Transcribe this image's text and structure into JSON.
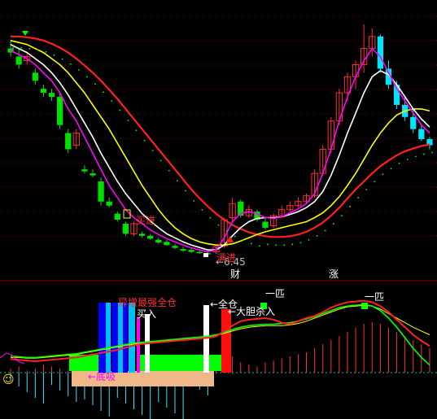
{
  "chart_data": [
    {
      "type": "candlestick",
      "title": "",
      "price_low_label": "6.45",
      "signals": {
        "buy_label": "买进",
        "fill_label": "满进",
        "buy_arrow_prefix": "←"
      },
      "badges": {
        "cai": "财",
        "zhang": "涨"
      },
      "candles": [
        {
          "o": 11.6,
          "h": 11.8,
          "l": 11.4,
          "c": 11.5,
          "up": false
        },
        {
          "o": 11.4,
          "h": 11.6,
          "l": 11.1,
          "c": 11.2,
          "up": false
        },
        {
          "o": 11.3,
          "h": 11.5,
          "l": 11.2,
          "c": 11.4,
          "up": true
        },
        {
          "o": 11.0,
          "h": 11.1,
          "l": 10.7,
          "c": 10.8,
          "up": false
        },
        {
          "o": 10.6,
          "h": 10.7,
          "l": 10.4,
          "c": 10.5,
          "up": false
        },
        {
          "o": 10.5,
          "h": 10.6,
          "l": 10.3,
          "c": 10.4,
          "up": false
        },
        {
          "o": 10.4,
          "h": 10.5,
          "l": 9.6,
          "c": 9.7,
          "up": false
        },
        {
          "o": 9.5,
          "h": 9.6,
          "l": 9.0,
          "c": 9.1,
          "up": false
        },
        {
          "o": 9.2,
          "h": 9.6,
          "l": 9.1,
          "c": 9.5,
          "up": true
        },
        {
          "o": 8.6,
          "h": 8.7,
          "l": 8.5,
          "c": 8.55,
          "up": false
        },
        {
          "o": 8.5,
          "h": 8.6,
          "l": 8.4,
          "c": 8.45,
          "up": false
        },
        {
          "o": 8.3,
          "h": 8.4,
          "l": 7.7,
          "c": 7.8,
          "up": false
        },
        {
          "o": 7.8,
          "h": 7.9,
          "l": 7.65,
          "c": 7.7,
          "up": false
        },
        {
          "o": 7.5,
          "h": 7.55,
          "l": 7.3,
          "c": 7.35,
          "up": false
        },
        {
          "o": 7.25,
          "h": 7.3,
          "l": 6.95,
          "c": 7.0,
          "up": false
        },
        {
          "o": 7.0,
          "h": 7.3,
          "l": 6.95,
          "c": 7.25,
          "up": true
        },
        {
          "o": 7.0,
          "h": 7.05,
          "l": 6.9,
          "c": 6.95,
          "up": false
        },
        {
          "o": 6.95,
          "h": 7.0,
          "l": 6.85,
          "c": 6.88,
          "up": false
        },
        {
          "o": 6.85,
          "h": 6.9,
          "l": 6.75,
          "c": 6.78,
          "up": false
        },
        {
          "o": 6.8,
          "h": 6.85,
          "l": 6.7,
          "c": 6.72,
          "up": false
        },
        {
          "o": 6.7,
          "h": 6.75,
          "l": 6.62,
          "c": 6.65,
          "up": false
        },
        {
          "o": 6.62,
          "h": 6.68,
          "l": 6.55,
          "c": 6.58,
          "up": false
        },
        {
          "o": 6.6,
          "h": 6.65,
          "l": 6.52,
          "c": 6.55,
          "up": false
        },
        {
          "o": 6.55,
          "h": 6.6,
          "l": 6.5,
          "c": 6.52,
          "up": false
        },
        {
          "o": 6.52,
          "h": 6.58,
          "l": 6.45,
          "c": 6.5,
          "up": false
        },
        {
          "o": 6.55,
          "h": 6.7,
          "l": 6.5,
          "c": 6.68,
          "up": true
        },
        {
          "o": 6.7,
          "h": 7.4,
          "l": 6.65,
          "c": 7.35,
          "up": true
        },
        {
          "o": 7.4,
          "h": 7.9,
          "l": 7.3,
          "c": 7.75,
          "up": true
        },
        {
          "o": 7.8,
          "h": 7.85,
          "l": 7.4,
          "c": 7.45,
          "up": false
        },
        {
          "o": 7.45,
          "h": 7.7,
          "l": 7.4,
          "c": 7.6,
          "up": true
        },
        {
          "o": 7.55,
          "h": 7.6,
          "l": 7.3,
          "c": 7.35,
          "up": false
        },
        {
          "o": 7.3,
          "h": 7.4,
          "l": 7.1,
          "c": 7.15,
          "up": false
        },
        {
          "o": 7.2,
          "h": 7.5,
          "l": 7.15,
          "c": 7.45,
          "up": true
        },
        {
          "o": 7.45,
          "h": 7.7,
          "l": 7.4,
          "c": 7.6,
          "up": true
        },
        {
          "o": 7.6,
          "h": 7.8,
          "l": 7.55,
          "c": 7.7,
          "up": true
        },
        {
          "o": 7.7,
          "h": 7.9,
          "l": 7.65,
          "c": 7.8,
          "up": true
        },
        {
          "o": 7.8,
          "h": 8.0,
          "l": 7.75,
          "c": 7.95,
          "up": true
        },
        {
          "o": 7.95,
          "h": 8.6,
          "l": 7.9,
          "c": 8.5,
          "up": true
        },
        {
          "o": 8.5,
          "h": 9.2,
          "l": 8.45,
          "c": 9.1,
          "up": true
        },
        {
          "o": 9.1,
          "h": 9.9,
          "l": 9.0,
          "c": 9.8,
          "up": true
        },
        {
          "o": 9.8,
          "h": 10.6,
          "l": 9.7,
          "c": 10.5,
          "up": true
        },
        {
          "o": 10.5,
          "h": 11.0,
          "l": 10.3,
          "c": 10.9,
          "up": true
        },
        {
          "o": 10.9,
          "h": 11.3,
          "l": 10.6,
          "c": 11.2,
          "up": true
        },
        {
          "o": 11.2,
          "h": 12.2,
          "l": 11.0,
          "c": 11.6,
          "up": true
        },
        {
          "o": 11.6,
          "h": 12.1,
          "l": 11.4,
          "c": 11.9,
          "up": true
        },
        {
          "o": 11.9,
          "h": 11.95,
          "l": 11.0,
          "c": 11.1,
          "up": false
        },
        {
          "o": 11.1,
          "h": 11.3,
          "l": 10.6,
          "c": 10.7,
          "up": false
        },
        {
          "o": 10.7,
          "h": 10.8,
          "l": 10.1,
          "c": 10.2,
          "up": false
        },
        {
          "o": 10.2,
          "h": 10.4,
          "l": 9.8,
          "c": 9.9,
          "up": false
        },
        {
          "o": 9.9,
          "h": 10.1,
          "l": 9.5,
          "c": 9.6,
          "up": false
        },
        {
          "o": 9.6,
          "h": 9.7,
          "l": 9.3,
          "c": 9.35,
          "up": false
        },
        {
          "o": 9.35,
          "h": 9.4,
          "l": 9.1,
          "c": 9.2,
          "up": false
        }
      ],
      "ma_fast": [
        11.55,
        11.45,
        11.35,
        11.2,
        11.0,
        10.8,
        10.5,
        10.1,
        9.8,
        9.4,
        9.0,
        8.6,
        8.2,
        7.9,
        7.6,
        7.4,
        7.25,
        7.1,
        6.98,
        6.88,
        6.8,
        6.72,
        6.65,
        6.6,
        6.55,
        6.6,
        6.9,
        7.3,
        7.5,
        7.55,
        7.5,
        7.4,
        7.38,
        7.42,
        7.52,
        7.62,
        7.75,
        8.0,
        8.5,
        9.1,
        9.8,
        10.4,
        10.9,
        11.3,
        11.6,
        11.4,
        11.0,
        10.6,
        10.3,
        10.0,
        9.7,
        9.5
      ],
      "ma_white": [
        11.7,
        11.6,
        11.5,
        11.35,
        11.2,
        11.0,
        10.75,
        10.45,
        10.1,
        9.75,
        9.4,
        9.0,
        8.65,
        8.3,
        8.0,
        7.75,
        7.5,
        7.32,
        7.15,
        7.0,
        6.9,
        6.8,
        6.72,
        6.66,
        6.6,
        6.6,
        6.72,
        6.95,
        7.15,
        7.3,
        7.38,
        7.4,
        7.4,
        7.42,
        7.48,
        7.55,
        7.65,
        7.8,
        8.05,
        8.45,
        8.95,
        9.5,
        10.0,
        10.5,
        10.9,
        11.05,
        10.95,
        10.7,
        10.4,
        10.1,
        9.85,
        9.65
      ],
      "ma_yellow": [
        11.8,
        11.75,
        11.7,
        11.6,
        11.5,
        11.35,
        11.2,
        11.0,
        10.75,
        10.5,
        10.2,
        9.9,
        9.6,
        9.25,
        8.9,
        8.55,
        8.2,
        7.9,
        7.6,
        7.35,
        7.15,
        7.0,
        6.88,
        6.8,
        6.75,
        6.72,
        6.72,
        6.75,
        6.82,
        6.9,
        6.98,
        7.05,
        7.1,
        7.15,
        7.2,
        7.25,
        7.3,
        7.4,
        7.52,
        7.7,
        7.92,
        8.2,
        8.5,
        8.85,
        9.2,
        9.5,
        9.75,
        9.95,
        10.05,
        10.1,
        10.1,
        10.05
      ],
      "ma_red": [
        11.9,
        11.9,
        11.88,
        11.85,
        11.8,
        11.72,
        11.62,
        11.5,
        11.35,
        11.18,
        11.0,
        10.8,
        10.58,
        10.35,
        10.1,
        9.85,
        9.6,
        9.35,
        9.1,
        8.85,
        8.6,
        8.35,
        8.1,
        7.88,
        7.68,
        7.5,
        7.35,
        7.22,
        7.12,
        7.04,
        6.98,
        6.94,
        6.92,
        6.92,
        6.94,
        6.98,
        7.05,
        7.15,
        7.28,
        7.45,
        7.65,
        7.88,
        8.1,
        8.3,
        8.5,
        8.68,
        8.82,
        8.95,
        9.05,
        9.12,
        9.18,
        9.22
      ],
      "ylim": [
        6.3,
        12.3
      ]
    },
    {
      "type": "indicator",
      "labels": {
        "bottom_suck": "←底吸",
        "left_notes": "异增最强全仓",
        "buy": "买入",
        "full_pos": "←全仓",
        "bold_pull": "←大胆杀入",
        "first_a": "一匹",
        "first_b": "一匹"
      },
      "histogram": [
        2,
        3,
        1,
        2,
        4,
        3,
        2,
        1,
        3,
        2,
        4,
        5,
        3,
        2,
        1,
        2,
        3,
        2,
        1,
        2,
        3,
        2,
        1,
        2,
        3,
        4,
        6,
        8,
        5,
        4,
        3,
        5,
        6,
        7,
        8,
        9,
        10,
        12,
        14,
        16,
        18,
        20,
        22,
        24,
        25,
        24,
        22,
        20,
        18,
        16,
        14,
        12
      ],
      "line_red": [
        0.18,
        0.17,
        0.16,
        0.15,
        0.16,
        0.17,
        0.18,
        0.19,
        0.2,
        0.22,
        0.24,
        0.26,
        0.28,
        0.3,
        0.33,
        0.36,
        0.38,
        0.39,
        0.4,
        0.41,
        0.42,
        0.43,
        0.44,
        0.45,
        0.46,
        0.48,
        0.55,
        0.62,
        0.68,
        0.7,
        0.71,
        0.72,
        0.7,
        0.66,
        0.64,
        0.68,
        0.72,
        0.75,
        0.8,
        0.86,
        0.9,
        0.93,
        0.94,
        0.95,
        0.93,
        0.88,
        0.8,
        0.7,
        0.6,
        0.5,
        0.42,
        0.35
      ],
      "line_yellow": [
        0.2,
        0.2,
        0.19,
        0.19,
        0.2,
        0.21,
        0.22,
        0.23,
        0.24,
        0.26,
        0.28,
        0.3,
        0.32,
        0.34,
        0.36,
        0.38,
        0.39,
        0.4,
        0.41,
        0.42,
        0.43,
        0.44,
        0.45,
        0.46,
        0.47,
        0.49,
        0.52,
        0.55,
        0.58,
        0.6,
        0.61,
        0.62,
        0.62,
        0.62,
        0.63,
        0.65,
        0.68,
        0.72,
        0.76,
        0.8,
        0.84,
        0.87,
        0.88,
        0.89,
        0.88,
        0.84,
        0.78,
        0.72,
        0.66,
        0.6,
        0.55,
        0.5
      ],
      "line_green": [
        0.22,
        0.21,
        0.2,
        0.2,
        0.21,
        0.22,
        0.23,
        0.24,
        0.25,
        0.27,
        0.29,
        0.31,
        0.33,
        0.35,
        0.37,
        0.39,
        0.4,
        0.41,
        0.42,
        0.43,
        0.44,
        0.45,
        0.46,
        0.47,
        0.48,
        0.5,
        0.53,
        0.57,
        0.6,
        0.62,
        0.63,
        0.64,
        0.64,
        0.65,
        0.66,
        0.68,
        0.71,
        0.74,
        0.78,
        0.82,
        0.86,
        0.88,
        0.89,
        0.9,
        0.88,
        0.82,
        0.72,
        0.6,
        0.46,
        0.32,
        0.2,
        0.1
      ]
    }
  ]
}
